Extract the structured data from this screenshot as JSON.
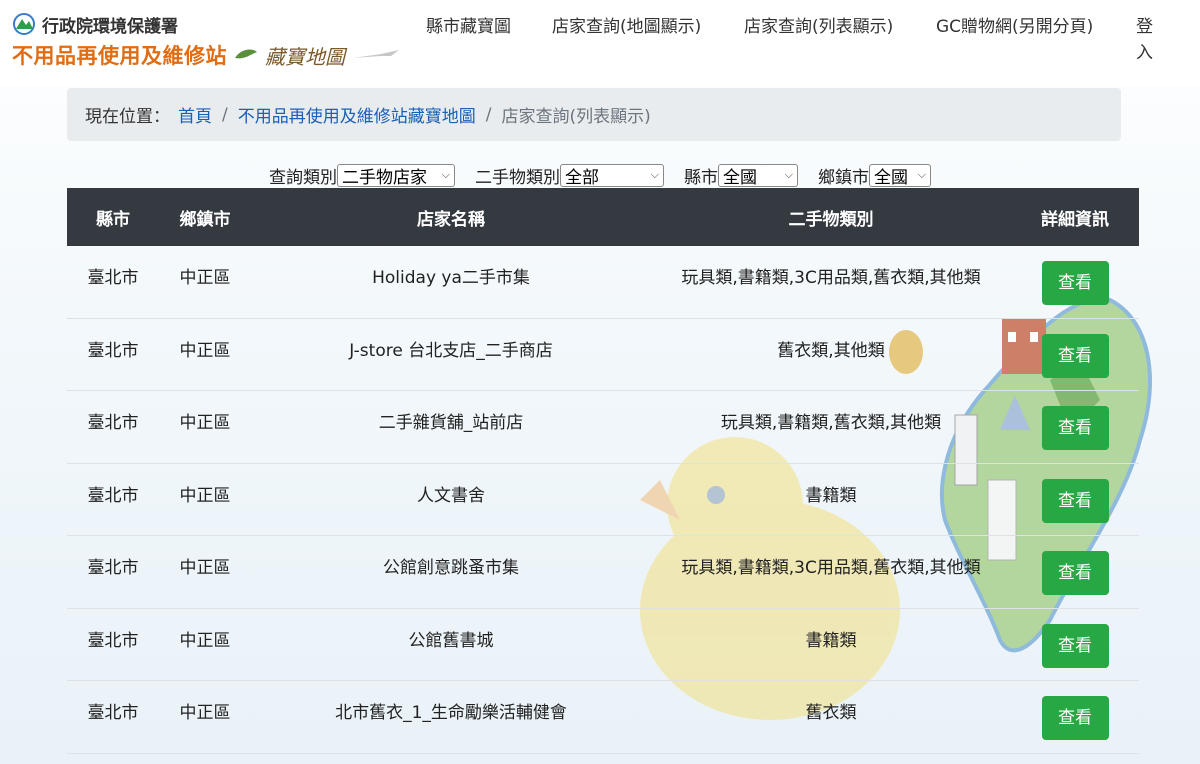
{
  "header": {
    "agency": "行政院環境保護署",
    "site_title": "不用品再使用及維修站",
    "map_title": "藏寶地圖",
    "nav": [
      {
        "label": "縣市藏寶圖"
      },
      {
        "label": "店家查詢(地圖顯示)"
      },
      {
        "label": "店家查詢(列表顯示)"
      },
      {
        "label": "GC贈物網(另開分頁)"
      },
      {
        "label": "登入"
      }
    ]
  },
  "breadcrumb": {
    "label": "現在位置：",
    "home": "首頁",
    "section": "不用品再使用及維修站藏寶地圖",
    "current": "店家查詢(列表顯示)"
  },
  "filters": {
    "category_label": "查詢類別",
    "category_value": "二手物店家",
    "type_label": "二手物類別",
    "type_value": "全部",
    "county_label": "縣市",
    "county_value": "全國",
    "town_label": "鄉鎮市",
    "town_value": "全國"
  },
  "table": {
    "headers": [
      "縣市",
      "鄉鎮市",
      "店家名稱",
      "二手物類別",
      "詳細資訊"
    ],
    "button_label": "查看",
    "rows": [
      {
        "county": "臺北市",
        "town": "中正區",
        "name": "Holiday ya二手市集",
        "types": "玩具類,書籍類,3C用品類,舊衣類,其他類"
      },
      {
        "county": "臺北市",
        "town": "中正區",
        "name": "J-store 台北支店_二手商店",
        "types": "舊衣類,其他類"
      },
      {
        "county": "臺北市",
        "town": "中正區",
        "name": "二手雜貨舖_站前店",
        "types": "玩具類,書籍類,舊衣類,其他類"
      },
      {
        "county": "臺北市",
        "town": "中正區",
        "name": "人文書舍",
        "types": "書籍類"
      },
      {
        "county": "臺北市",
        "town": "中正區",
        "name": "公館創意跳蚤市集",
        "types": "玩具類,書籍類,3C用品類,舊衣類,其他類"
      },
      {
        "county": "臺北市",
        "town": "中正區",
        "name": "公館舊書城",
        "types": "書籍類"
      },
      {
        "county": "臺北市",
        "town": "中正區",
        "name": "北市舊衣_1_生命勵樂活輔健會",
        "types": "舊衣類"
      }
    ]
  },
  "colors": {
    "accent_green": "#28a745",
    "table_header": "#343a40",
    "link": "#1a5fb4",
    "title_orange": "#e06d14"
  }
}
